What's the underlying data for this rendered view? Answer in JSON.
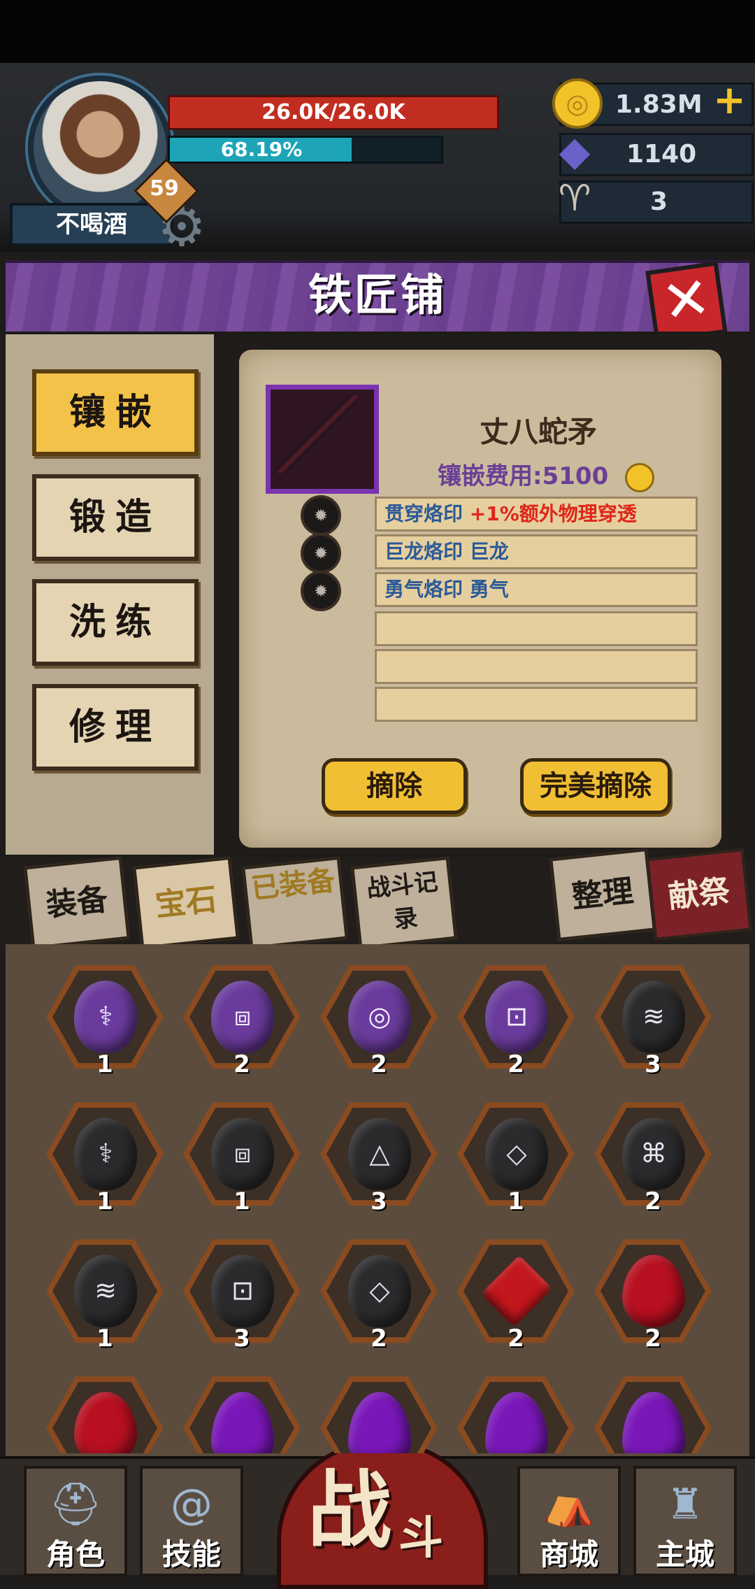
{
  "player": {
    "name": "不喝酒",
    "level": "59",
    "hp_text": "26.0K/26.0K",
    "hp_fraction": 1.0,
    "xp_text": "68.19%",
    "xp_fraction": 0.6819
  },
  "resources": {
    "gold": "1.83M",
    "gold_plus": "+",
    "crystal": "1140",
    "horn": "3"
  },
  "title": "铁匠铺",
  "close_symbol": "✕",
  "side_menu": [
    "镶嵌",
    "锻造",
    "洗练",
    "修理"
  ],
  "side_menu_active": "镶嵌",
  "weapon": {
    "name": "丈八蛇矛",
    "cost_label": "镶嵌费用:",
    "cost_value": "5100"
  },
  "sockets": [
    {
      "name": "贯穿烙印",
      "effect": "+1%额外物理穿透",
      "effect_color": "#e0261a"
    },
    {
      "name": "巨龙烙印",
      "effect": "巨龙",
      "effect_color": "#2b5a98"
    },
    {
      "name": "勇气烙印",
      "effect": "勇气",
      "effect_color": "#2b5a98"
    },
    {
      "name": "",
      "effect": ""
    },
    {
      "name": "",
      "effect": ""
    },
    {
      "name": "",
      "effect": ""
    }
  ],
  "actions": {
    "remove": "摘除",
    "perfect_remove": "完美摘除"
  },
  "tabs": [
    "装备",
    "宝石",
    "已装备",
    "战斗记录",
    "整理",
    "献祭"
  ],
  "inventory": [
    {
      "type": "purple",
      "glyph": "⚕",
      "count": "1"
    },
    {
      "type": "purple",
      "glyph": "⧈",
      "count": "2"
    },
    {
      "type": "purple",
      "glyph": "◎",
      "count": "2"
    },
    {
      "type": "purple",
      "glyph": "⊡",
      "count": "2"
    },
    {
      "type": "black",
      "glyph": "≋",
      "count": "3"
    },
    {
      "type": "black",
      "glyph": "⚕",
      "count": "1"
    },
    {
      "type": "black",
      "glyph": "⧈",
      "count": "1"
    },
    {
      "type": "black",
      "glyph": "△",
      "count": "3"
    },
    {
      "type": "black",
      "glyph": "◇",
      "count": "1"
    },
    {
      "type": "black",
      "glyph": "⌘",
      "count": "2"
    },
    {
      "type": "black",
      "glyph": "≋",
      "count": "1"
    },
    {
      "type": "black",
      "glyph": "⊡",
      "count": "3"
    },
    {
      "type": "black",
      "glyph": "◇",
      "count": "2"
    },
    {
      "type": "red",
      "glyph": "",
      "count": "2"
    },
    {
      "type": "ruby",
      "glyph": "",
      "count": "2"
    },
    {
      "type": "ruby",
      "glyph": "",
      "count": ""
    },
    {
      "type": "amethyst",
      "glyph": "",
      "count": ""
    },
    {
      "type": "amethyst",
      "glyph": "",
      "count": ""
    },
    {
      "type": "amethyst",
      "glyph": "",
      "count": ""
    },
    {
      "type": "amethyst",
      "glyph": "",
      "count": ""
    }
  ],
  "bottom_nav": {
    "character": "角色",
    "skills": "技能",
    "battle_big": "战",
    "battle_small": "斗",
    "shop": "商城",
    "city": "主城"
  },
  "colors": {
    "hp": "#c12e21",
    "xp": "#1ea4b7",
    "title_bar": "#6a3f8f",
    "accent_gold": "#f1bf34",
    "cost_text": "#6b3f96"
  }
}
